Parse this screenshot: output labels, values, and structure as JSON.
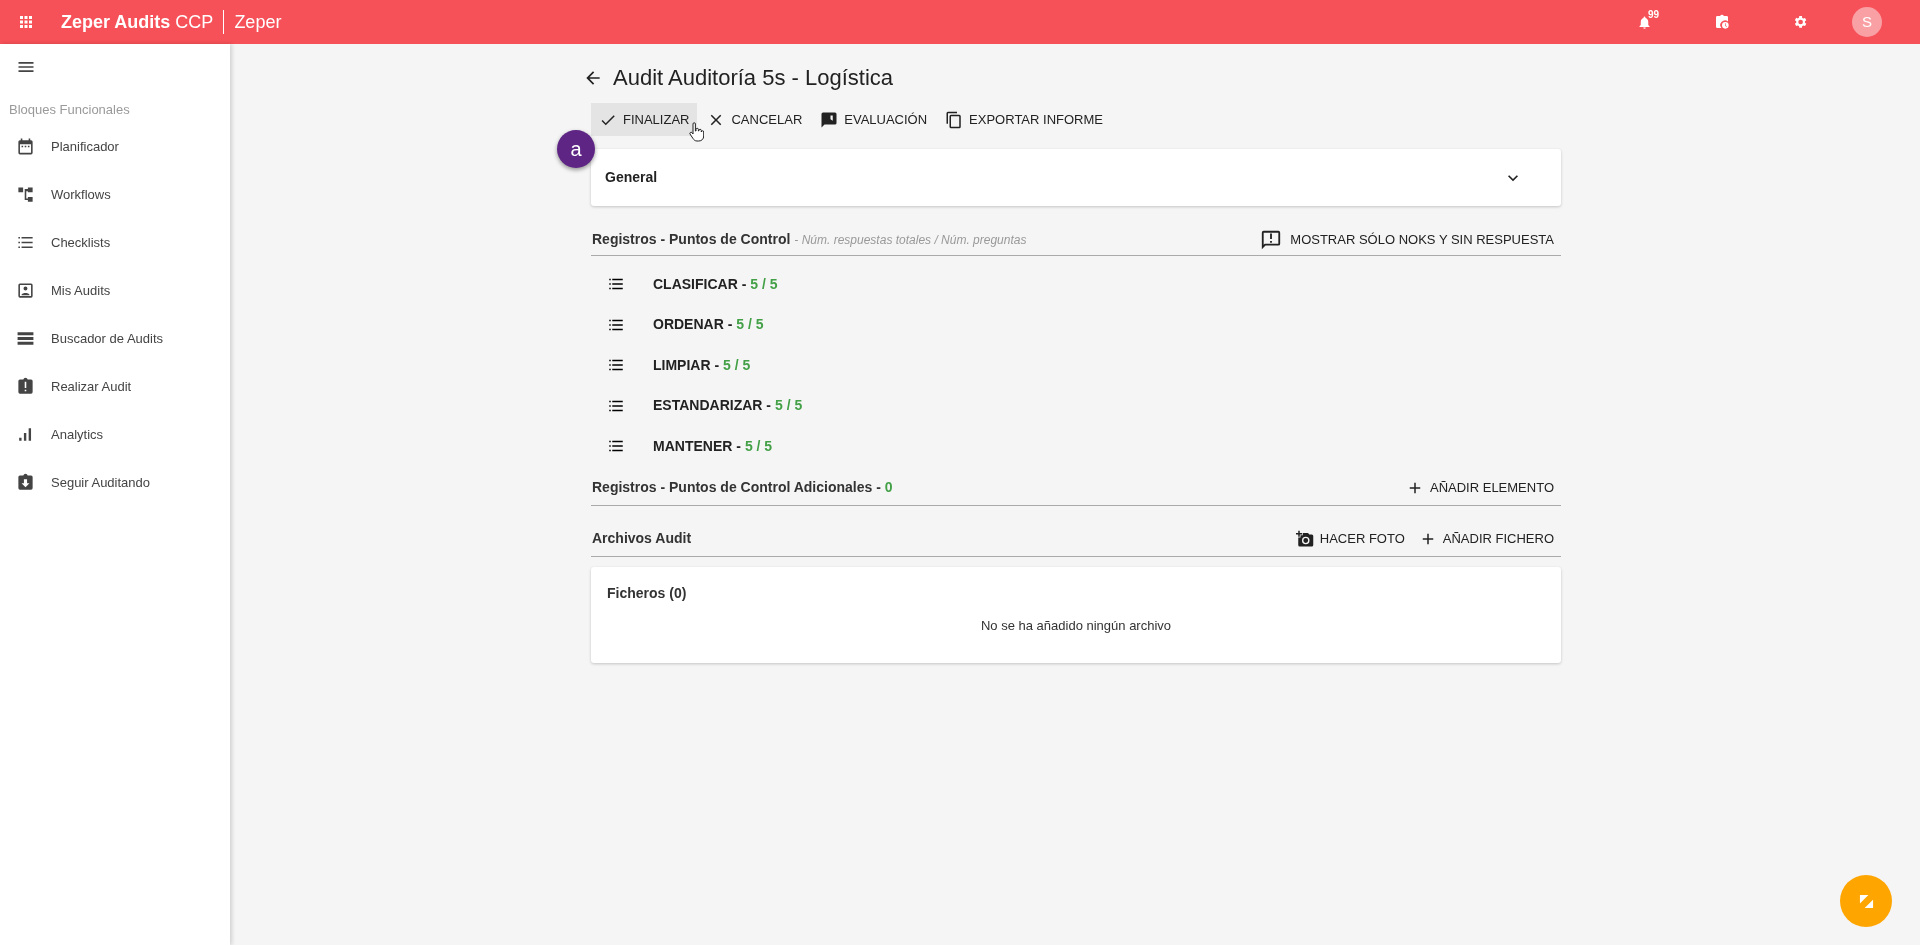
{
  "topbar": {
    "app_name": "Zeper Audits",
    "app_suffix": "CCP",
    "org": "Zeper",
    "notifications_badge": "99",
    "avatar": "S"
  },
  "sidebar": {
    "section": "Bloques Funcionales",
    "items": [
      {
        "label": "Planificador"
      },
      {
        "label": "Workflows"
      },
      {
        "label": "Checklists"
      },
      {
        "label": "Mis Audits"
      },
      {
        "label": "Buscador de Audits"
      },
      {
        "label": "Realizar Audit"
      },
      {
        "label": "Analytics"
      },
      {
        "label": "Seguir Auditando"
      }
    ]
  },
  "page": {
    "title": "Audit Auditoría 5s - Logística",
    "actions": [
      {
        "label": "FINALIZAR",
        "highlighted": true
      },
      {
        "label": "CANCELAR",
        "highlighted": false
      },
      {
        "label": "EVALUACIÓN",
        "highlighted": false
      },
      {
        "label": "EXPORTAR INFORME",
        "highlighted": false
      }
    ],
    "annotation_badge": "a",
    "general_panel": {
      "title": "General",
      "expanded": false
    },
    "controls_section": {
      "title": "Registros - Puntos de Control",
      "subtitle": "- Núm. respuestas totales / Núm. preguntas",
      "action": "MOSTRAR SÓLO NOKS Y SIN RESPUESTA",
      "items": [
        {
          "name": "CLASIFICAR -",
          "score": "5 / 5"
        },
        {
          "name": "ORDENAR -",
          "score": "5 / 5"
        },
        {
          "name": "LIMPIAR -",
          "score": "5 / 5"
        },
        {
          "name": "ESTANDARIZAR -",
          "score": "5 / 5"
        },
        {
          "name": "MANTENER -",
          "score": "5 / 5"
        }
      ]
    },
    "additional_section": {
      "title": "Registros - Puntos de Control Adicionales -",
      "count": "0",
      "action": "AÑADIR ELEMENTO"
    },
    "files_section": {
      "title": "Archivos Audit",
      "actions": [
        {
          "label": "HACER FOTO"
        },
        {
          "label": "AÑADIR FICHERO"
        }
      ],
      "card_title": "Ficheros (0)",
      "empty_message": "No se ha añadido ningún archivo"
    }
  }
}
